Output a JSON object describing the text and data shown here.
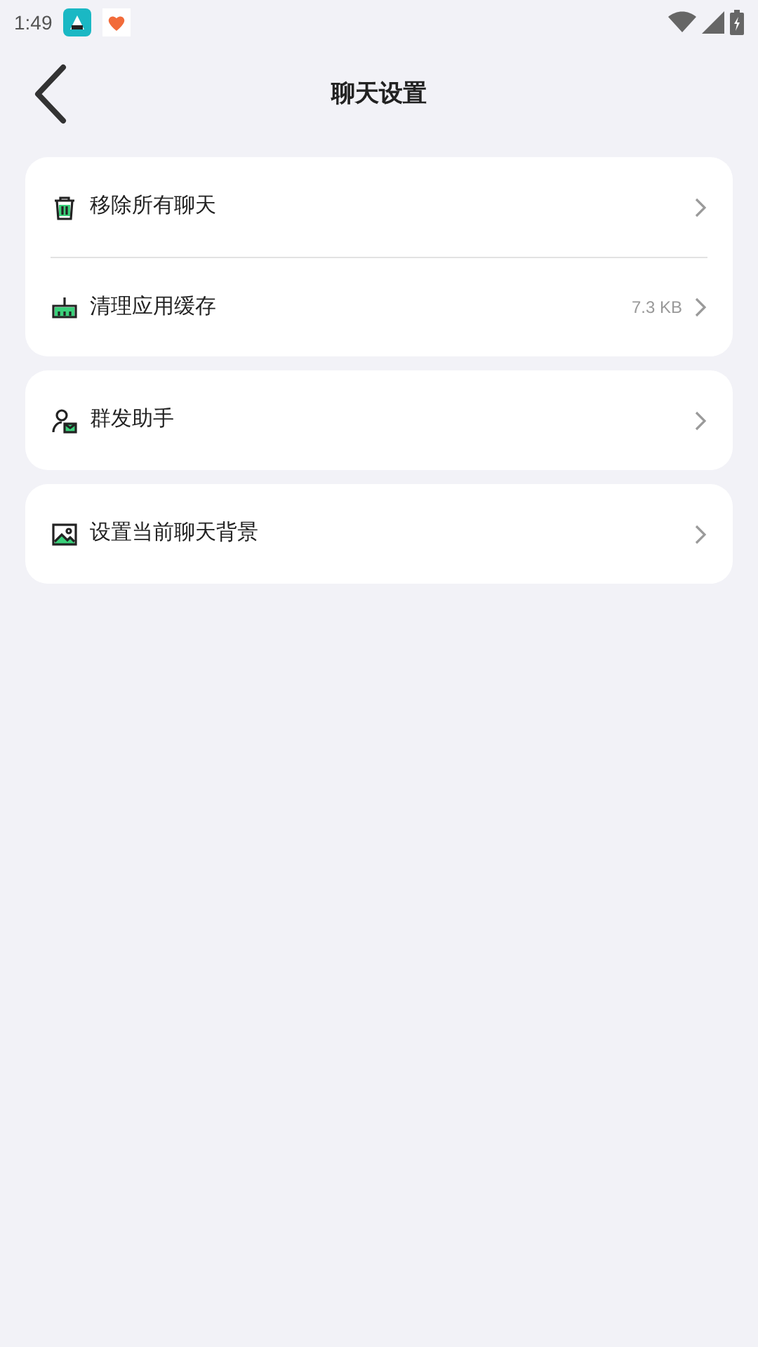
{
  "status_bar": {
    "time": "1:49"
  },
  "header": {
    "title": "聊天设置"
  },
  "groups": [
    {
      "items": [
        {
          "kind": "trash",
          "label": "移除所有聊天"
        },
        {
          "kind": "broom",
          "label": "清理应用缓存",
          "value": "7.3 KB"
        }
      ]
    },
    {
      "items": [
        {
          "kind": "broadcast",
          "label": "群发助手"
        }
      ]
    },
    {
      "items": [
        {
          "kind": "image",
          "label": "设置当前聊天背景"
        }
      ]
    }
  ]
}
